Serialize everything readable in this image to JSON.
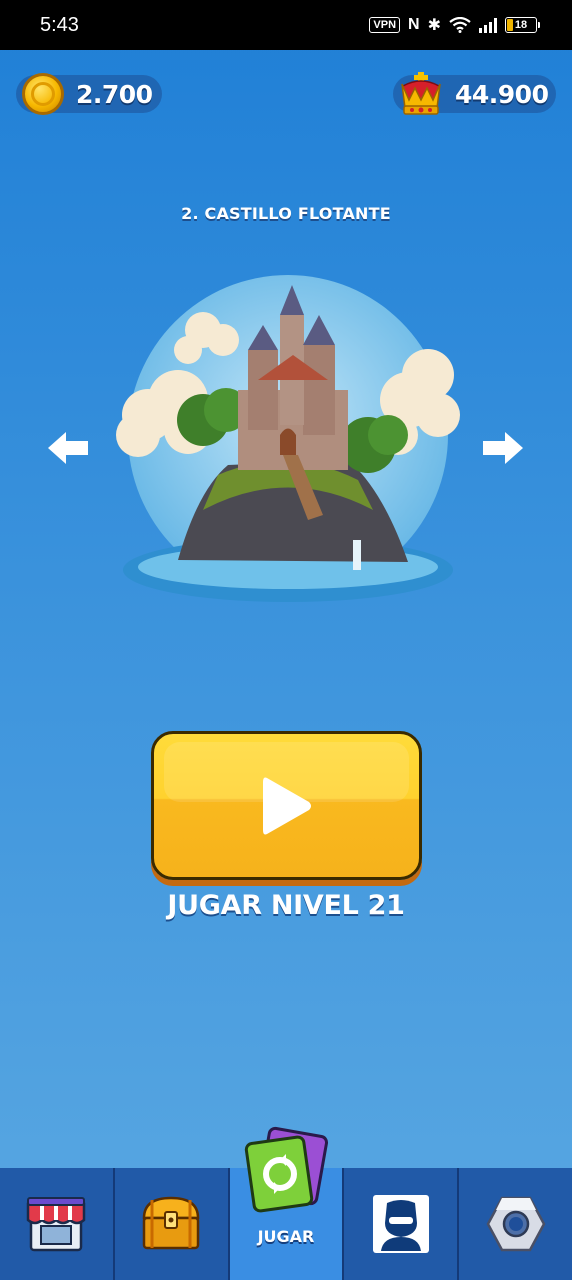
{
  "status_bar": {
    "time": "5:43",
    "vpn": "VPN",
    "battery": "18",
    "icons": [
      "vpn-badge",
      "nfc-icon",
      "bluetooth-icon",
      "wifi-icon",
      "signal-icon",
      "battery-icon"
    ]
  },
  "currency": {
    "coins": "2.700",
    "crowns": "44.900"
  },
  "level": {
    "title": "2. CASTILLO FLOTANTE"
  },
  "play": {
    "label": "JUGAR NIVEL 21"
  },
  "nav": {
    "items": [
      {
        "name": "shop",
        "icon": "shop-icon"
      },
      {
        "name": "chest",
        "icon": "treasure-chest-icon"
      },
      {
        "name": "play",
        "icon": "cards-icon",
        "label": "JUGAR",
        "active": true
      },
      {
        "name": "profile",
        "icon": "profile-icon"
      },
      {
        "name": "settings",
        "icon": "nut-icon"
      }
    ]
  },
  "colors": {
    "background_top": "#1f7fd6",
    "background_bottom": "#5aa8e2",
    "play_button": "#ffd22e",
    "nav_bar": "#215aa8",
    "nav_active": "#3a8ee3"
  }
}
